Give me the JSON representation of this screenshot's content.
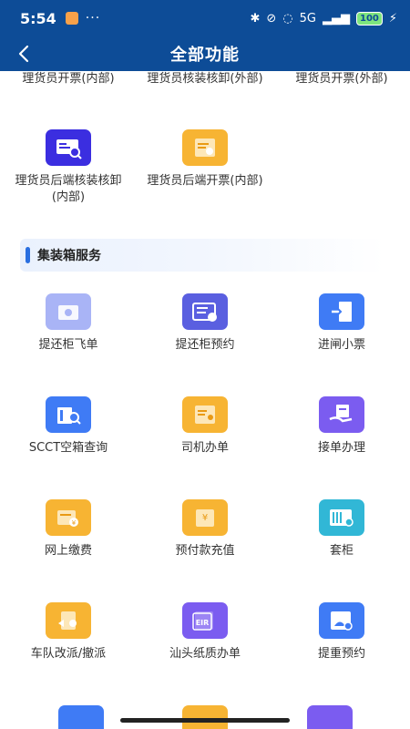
{
  "status": {
    "time": "5:54",
    "dots": "···",
    "network": "5G",
    "battery": "100"
  },
  "header": {
    "title": "全部功能"
  },
  "top_row": [
    {
      "label": "理货员开票(内部)"
    },
    {
      "label": "理货员核装核卸(外部)"
    },
    {
      "label": "理货员开票(外部)"
    }
  ],
  "tally_items": [
    {
      "label": "理货员后端核装核卸(内部)",
      "icon": "receipt-search-icon",
      "color": "#3b2ee0"
    },
    {
      "label": "理货员后端开票(内部)",
      "icon": "document-edit-icon",
      "color": "#f7b433"
    }
  ],
  "section": {
    "title": "集装箱服务"
  },
  "container_items": [
    {
      "label": "提还柜飞单",
      "icon": "camera-icon",
      "color": "#a9b4f6"
    },
    {
      "label": "提还柜预约",
      "icon": "calendar-icon",
      "color": "#5a5fe0"
    },
    {
      "label": "进闸小票",
      "icon": "door-enter-icon",
      "color": "#3f7bf5"
    },
    {
      "label": "SCCT空箱查询",
      "icon": "container-search-icon",
      "color": "#3f7bf5"
    },
    {
      "label": "司机办单",
      "icon": "driver-document-icon",
      "color": "#f7b433"
    },
    {
      "label": "接单办理",
      "icon": "hand-document-icon",
      "color": "#7b5cf0"
    },
    {
      "label": "网上缴费",
      "icon": "payment-icon",
      "color": "#f7b433"
    },
    {
      "label": "预付款充值",
      "icon": "wallet-icon",
      "color": "#f7b433"
    },
    {
      "label": "套柜",
      "icon": "container-plus-icon",
      "color": "#31b7d6"
    },
    {
      "label": "车队改派/撤派",
      "icon": "fleet-reassign-icon",
      "color": "#f7b433"
    },
    {
      "label": "汕头纸质办单",
      "icon": "eir-document-icon",
      "color": "#7b5cf0",
      "badge": "EIR"
    },
    {
      "label": "提重预约",
      "icon": "pickup-appointment-icon",
      "color": "#3f7bf5"
    }
  ],
  "partial_row": [
    {
      "icon": "app-icon",
      "color": "#3f7bf5"
    },
    {
      "icon": "app-icon",
      "color": "#f7b433"
    },
    {
      "icon": "app-icon",
      "color": "#7b5cf0"
    }
  ]
}
